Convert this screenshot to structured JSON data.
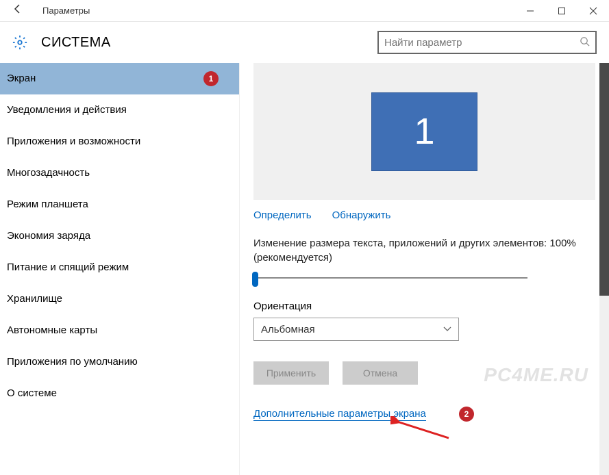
{
  "titlebar": {
    "title": "Параметры"
  },
  "header": {
    "section_title": "СИСТЕМА",
    "search_placeholder": "Найти параметр"
  },
  "sidebar": {
    "items": [
      {
        "label": "Экран",
        "active": true
      },
      {
        "label": "Уведомления и действия"
      },
      {
        "label": "Приложения и возможности"
      },
      {
        "label": "Многозадачность"
      },
      {
        "label": "Режим планшета"
      },
      {
        "label": "Экономия заряда"
      },
      {
        "label": "Питание и спящий режим"
      },
      {
        "label": "Хранилище"
      },
      {
        "label": "Автономные карты"
      },
      {
        "label": "Приложения по умолчанию"
      },
      {
        "label": "О системе"
      }
    ]
  },
  "main": {
    "monitor_number": "1",
    "identify": "Определить",
    "detect": "Обнаружить",
    "scale_label": "Изменение размера текста, приложений и других элементов: 100% (рекомендуется)",
    "orientation_label": "Ориентация",
    "orientation_value": "Альбомная",
    "apply": "Применить",
    "cancel": "Отмена",
    "advanced": "Дополнительные параметры экрана"
  },
  "annotations": {
    "badge1": "1",
    "badge2": "2"
  },
  "watermark": "PC4ME.RU"
}
